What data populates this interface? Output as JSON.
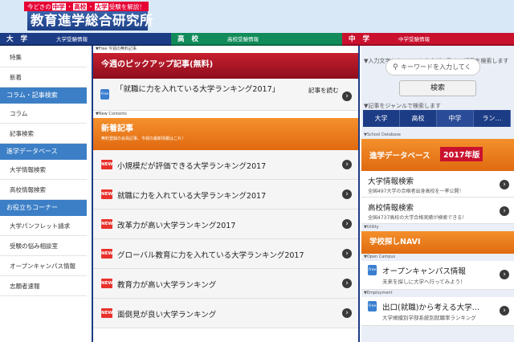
{
  "header": {
    "tagline_pre": "今どきの",
    "tagline_hl": [
      "中学",
      "高校",
      "大学"
    ],
    "tagline_post": "受験を解説！",
    "logo": "教育進学総合研究所"
  },
  "nav": [
    {
      "label": "大学",
      "sub": "大学受験情報"
    },
    {
      "label": "高校",
      "sub": "高校受験情報"
    },
    {
      "label": "中学",
      "sub": "中学受験情報"
    }
  ],
  "sidebar": {
    "items": [
      {
        "type": "item",
        "label": "特集"
      },
      {
        "type": "item",
        "label": "新着"
      },
      {
        "type": "head",
        "label": "コラム・記事検索"
      },
      {
        "type": "item",
        "label": "コラム"
      },
      {
        "type": "item",
        "label": "記事検索"
      },
      {
        "type": "head",
        "label": "進学データベース"
      },
      {
        "type": "item",
        "label": "大学情報検索"
      },
      {
        "type": "item",
        "label": "高校情報検索"
      },
      {
        "type": "head",
        "label": "お役立ちコーナー"
      },
      {
        "type": "item",
        "label": "大学パンフレット請求"
      },
      {
        "type": "item",
        "label": "受験の悩み相談室"
      },
      {
        "type": "item",
        "label": "オープンキャンパス情報"
      },
      {
        "type": "item",
        "label": "志願者速報"
      }
    ]
  },
  "main": {
    "free_label": "▼Free 今週の無料記事",
    "pickup_title": "今週のピックアップ記事(無料)",
    "pickup_item": "「就職に力を入れている大学ランキング2017」",
    "pickup_read": "記事を読む",
    "free_badge": "Free",
    "new_label": "▼New Contents",
    "new_title": "新着記事",
    "new_sub": "無料登録の会員記事、今週の最新情報はこれ！",
    "new_badge": "NEW",
    "articles": [
      "小規模だが評価できる大学ランキング2017",
      "就職に力を入れている大学ランキング2017",
      "改革力が高い大学ランキング2017",
      "グローバル教育に力を入れている大学ランキング2017",
      "教育力が高い大学ランキング",
      "面倒見が良い大学ランキング"
    ]
  },
  "right": {
    "search_desc": "▼入力文字とタイトルか本文が一致する記事を検索します",
    "search_placeholder": "キーワードを入力してく",
    "search_button": "検索",
    "genre_label": "▼記事をジャンルで検索します",
    "genre_tabs": [
      "大学",
      "高校",
      "中学",
      "ラン…"
    ],
    "db_label": "▼School Database",
    "db_title": "進学データベース",
    "db_year": "2017年版",
    "db_items": [
      {
        "title": "大学情報検索",
        "sub": "全国497大学の合格者出身高校を一挙公開！"
      },
      {
        "title": "高校情報検索",
        "sub": "全国4737高校の大学合格実績が検索できる！"
      }
    ],
    "utility_label": "▼Utility",
    "navi_title": "学校探しNAVI",
    "oc_label": "▼Open Campus",
    "oc_title": "オープンキャンパス情報",
    "oc_sub": "未来を探しに大学へ行ってみよう！",
    "emp_label": "▼Employment",
    "emp_title": "出口(就職)から考える大学…",
    "emp_sub": "大学規模別学部系統別就職率ランキング"
  }
}
